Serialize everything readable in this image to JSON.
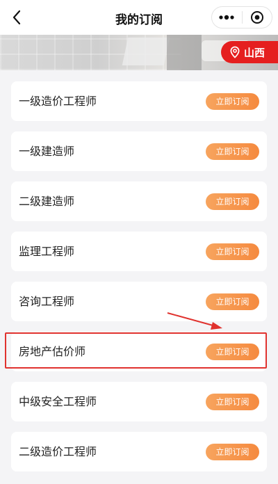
{
  "header": {
    "title": "我的订阅"
  },
  "location": {
    "city": "山西"
  },
  "subscriptions": [
    {
      "name": "一级造价工程师",
      "button": "立即订阅"
    },
    {
      "name": "一级建造师",
      "button": "立即订阅"
    },
    {
      "name": "二级建造师",
      "button": "立即订阅"
    },
    {
      "name": "监理工程师",
      "button": "立即订阅"
    },
    {
      "name": "咨询工程师",
      "button": "立即订阅"
    },
    {
      "name": "房地产估价师",
      "button": "立即订阅"
    },
    {
      "name": "中级安全工程师",
      "button": "立即订阅"
    },
    {
      "name": "二级造价工程师",
      "button": "立即订阅"
    }
  ],
  "icons": [
    "back-arrow-icon",
    "more-dots-icon",
    "close-circle-icon",
    "location-pin-icon"
  ],
  "colors": {
    "accent": "#e51f1f",
    "button_start": "#f7a45e",
    "button_end": "#f58a3f",
    "background": "#f4f4f6"
  }
}
